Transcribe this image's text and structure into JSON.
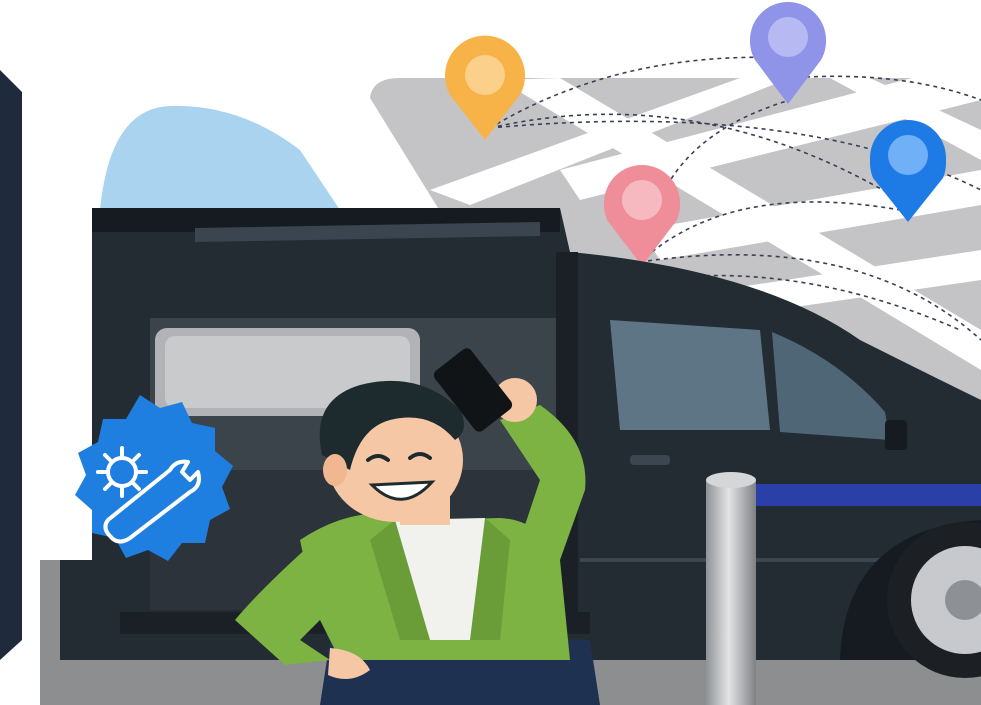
{
  "scene": {
    "description_icons": [
      "location-pin-icon",
      "gear-wrench-icon",
      "smartphone-icon"
    ],
    "colors": {
      "background": "#ffffff",
      "map_block": "#c4c4c6",
      "map_road": "#ffffff",
      "sky_shape": "#a9d3ef",
      "van_body": "#232b33",
      "van_dark": "#151b21",
      "van_window": "#5d7585",
      "ground": "#8d8e90",
      "stripe": "#2a3fa8",
      "pin_orange": "#f7b348",
      "pin_purple": "#8f94e8",
      "pin_blue": "#1e7be6",
      "pin_pink": "#ef8e98",
      "badge_blue": "#1f7fe0",
      "jacket_green": "#7cb342",
      "shirt": "#f1f1ee",
      "pants": "#1f3150",
      "skin": "#f6c7a4",
      "hair": "#1d2b2f",
      "pole": "#b7b9bc"
    }
  }
}
